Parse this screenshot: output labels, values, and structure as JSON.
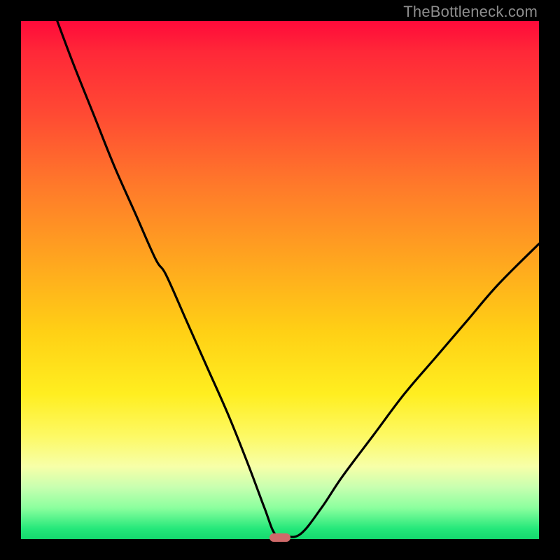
{
  "watermark": "TheBottleneck.com",
  "colors": {
    "frame": "#000000",
    "gradient_top": "#ff0a3a",
    "gradient_mid": "#ffd015",
    "gradient_bottom": "#14d86e",
    "curve": "#000000",
    "marker": "#cf6a6a"
  },
  "chart_data": {
    "type": "line",
    "title": "",
    "xlabel": "",
    "ylabel": "",
    "xlim": [
      0,
      100
    ],
    "ylim": [
      0,
      100
    ],
    "notes": "V-shaped bottleneck curve. x is component-strength axis, y is bottleneck percentage. Minimum (~0%) near x≈48–52. Left arm starts at ~100% at x≈7 and descends steeply. Right arm rises to ~57% at x=100.",
    "series": [
      {
        "name": "bottleneck-curve",
        "x": [
          7,
          10,
          14,
          18,
          22,
          26,
          28,
          32,
          36,
          40,
          44,
          47,
          49,
          51,
          54,
          58,
          62,
          68,
          74,
          80,
          86,
          92,
          100
        ],
        "y": [
          100,
          92,
          82,
          72,
          63,
          54,
          51,
          42,
          33,
          24,
          14,
          6,
          1,
          0.5,
          1,
          6,
          12,
          20,
          28,
          35,
          42,
          49,
          57
        ]
      }
    ],
    "optimum_marker": {
      "x_start": 48,
      "x_end": 52,
      "y": 0
    }
  }
}
